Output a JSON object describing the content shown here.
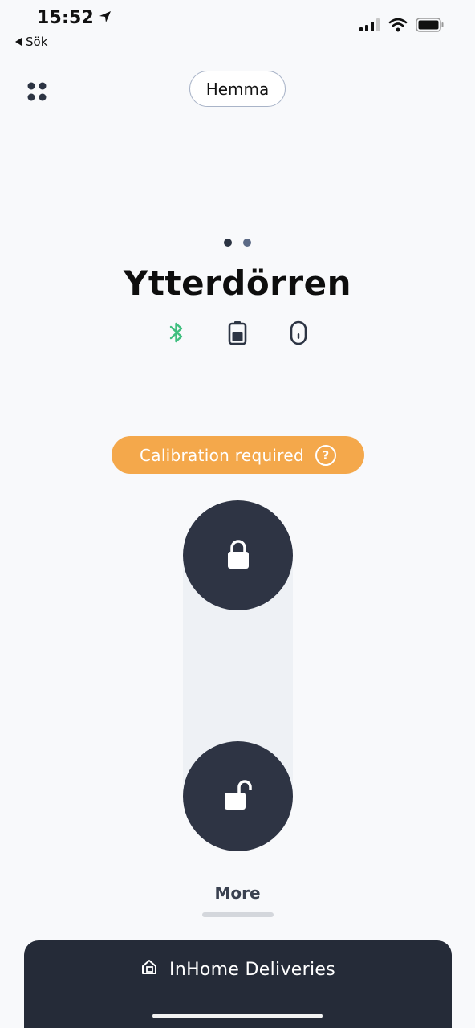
{
  "status_bar": {
    "time": "15:52",
    "back_label": "Sök",
    "icons": [
      "location-arrow-icon",
      "cellular-signal-icon",
      "wifi-icon",
      "battery-icon"
    ]
  },
  "header": {
    "menu_icon": "grid-dots-icon",
    "location_label": "Hemma"
  },
  "lock": {
    "name": "Ytterdörren",
    "status_icons": [
      "bluetooth-icon",
      "battery-icon",
      "device-icon"
    ],
    "bluetooth_color": "#3fbf7f"
  },
  "calibration": {
    "label": "Calibration required",
    "color": "#f4a84b"
  },
  "controls": {
    "lock_icon": "lock-closed-icon",
    "unlock_icon": "lock-open-icon",
    "more_label": "More"
  },
  "sheet": {
    "icon": "home-package-icon",
    "label": "InHome Deliveries"
  }
}
